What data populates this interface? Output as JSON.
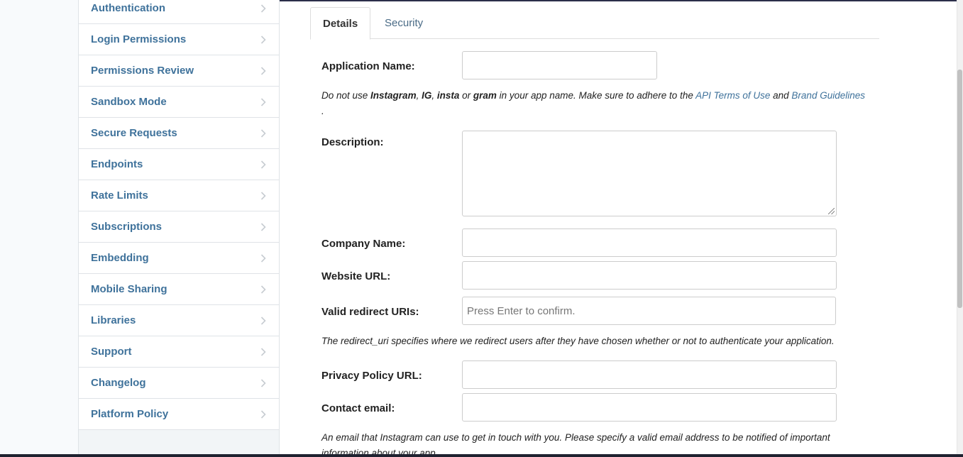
{
  "sidebar": {
    "items": [
      {
        "label": "Authentication"
      },
      {
        "label": "Login Permissions"
      },
      {
        "label": "Permissions Review"
      },
      {
        "label": "Sandbox Mode"
      },
      {
        "label": "Secure Requests"
      },
      {
        "label": "Endpoints"
      },
      {
        "label": "Rate Limits"
      },
      {
        "label": "Subscriptions"
      },
      {
        "label": "Embedding"
      },
      {
        "label": "Mobile Sharing"
      },
      {
        "label": "Libraries"
      },
      {
        "label": "Support"
      },
      {
        "label": "Changelog"
      },
      {
        "label": "Platform Policy"
      }
    ]
  },
  "tabs": {
    "details": "Details",
    "security": "Security"
  },
  "form": {
    "app_name_label": "Application Name:",
    "app_name_value": "",
    "app_name_help": {
      "part1": "Do not use ",
      "word1": "Instagram",
      "sep1": ", ",
      "word2": "IG",
      "sep2": ", ",
      "word3": "insta",
      "sep3": " or ",
      "word4": "gram",
      "part2": " in your app name. Make sure to adhere to the ",
      "link1": "API Terms of Use",
      "part3": " and ",
      "link2": "Brand Guidelines",
      "part4": "."
    },
    "description_label": "Description:",
    "description_value": "",
    "company_label": "Company Name:",
    "company_value": "",
    "website_label": "Website URL:",
    "website_value": "",
    "redirect_label": "Valid redirect URIs:",
    "redirect_placeholder": "Press Enter to confirm.",
    "redirect_help": "The redirect_uri specifies where we redirect users after they have chosen whether or not to authenticate your application.",
    "privacy_label": "Privacy Policy URL:",
    "privacy_value": "",
    "email_label": "Contact email:",
    "email_value": "",
    "email_help": "An email that Instagram can use to get in touch with you. Please specify a valid email address to be notified of important information about your app."
  },
  "icons": {
    "sidebar_chevron": "chevron-right-icon"
  },
  "colors": {
    "link": "#3f729b",
    "sidebar_bg": "#f2f5f7"
  }
}
